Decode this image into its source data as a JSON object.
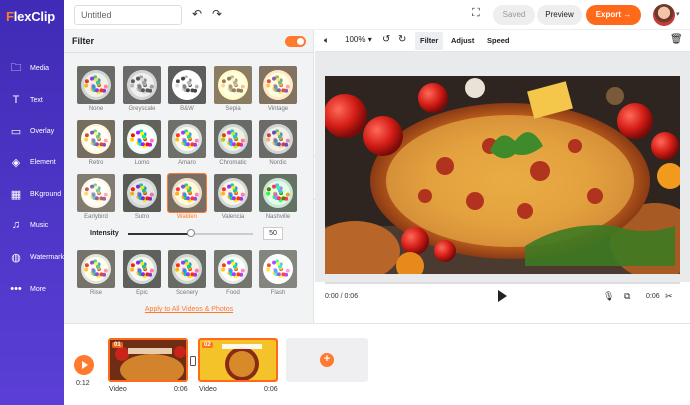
{
  "app": {
    "logo_mark": "F",
    "logo_rest": "lexClip"
  },
  "sidebar": {
    "items": [
      {
        "label": "Media",
        "icon": "folder-icon",
        "glyph": "🗀"
      },
      {
        "label": "Text",
        "icon": "text-icon",
        "glyph": "T"
      },
      {
        "label": "Overlay",
        "icon": "overlay-icon",
        "glyph": "▭"
      },
      {
        "label": "Element",
        "icon": "element-icon",
        "glyph": "◈"
      },
      {
        "label": "BKground",
        "icon": "background-icon",
        "glyph": "▦"
      },
      {
        "label": "Music",
        "icon": "music-icon",
        "glyph": "♫"
      },
      {
        "label": "Watermark",
        "icon": "watermark-icon",
        "glyph": "◍"
      },
      {
        "label": "More",
        "icon": "more-icon",
        "glyph": "•••"
      }
    ]
  },
  "header": {
    "project_title": "Untitled",
    "saved_label": "Saved",
    "preview_label": "Preview",
    "export_label": "Export →",
    "accent": "#ff6a1a"
  },
  "filter_panel": {
    "title": "Filter",
    "enabled": true,
    "filters": [
      "None",
      "Greyscale",
      "B&W",
      "Sepia",
      "Vintage",
      "Retro",
      "Lomo",
      "Amaro",
      "Chromatic",
      "Nordic",
      "Earlybird",
      "Sutro",
      "Walden",
      "Valencia",
      "Nashville",
      "Rise",
      "Epic",
      "Scenery",
      "Food",
      "Flash"
    ],
    "selected_filter": "Walden",
    "intensity_label": "Intensity",
    "intensity_value": "50",
    "apply_all": "Apply to All Videos & Photos"
  },
  "preview": {
    "zoom": "100%",
    "tabs": [
      "Filter",
      "Adjust",
      "Speed"
    ],
    "active_tab": "Filter",
    "current_time": "0:00 / 0:06",
    "duration": "0:06"
  },
  "timeline": {
    "time": "0:12",
    "clips": [
      {
        "num": "01",
        "label": "Video",
        "duration": "0:06",
        "selected": true
      },
      {
        "num": "02",
        "label": "Video",
        "duration": "0:06",
        "selected": false
      }
    ]
  }
}
